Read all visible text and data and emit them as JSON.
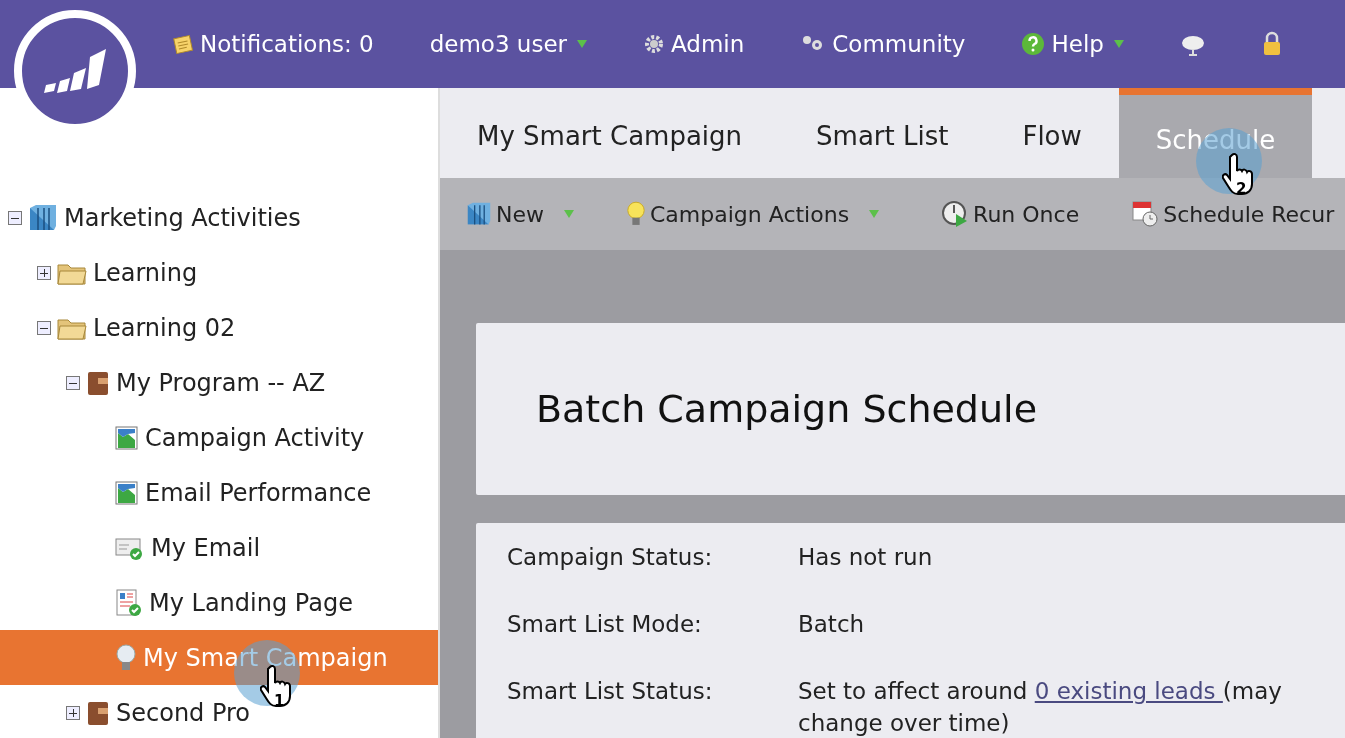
{
  "top_bar": {
    "items": [
      {
        "kind": "notifications",
        "label": "Notifications: 0",
        "has_menu": false
      },
      {
        "kind": "user",
        "label": "demo3 user",
        "has_menu": true
      },
      {
        "kind": "admin",
        "label": "Admin",
        "has_menu": false
      },
      {
        "kind": "community",
        "label": "Community",
        "has_menu": false
      },
      {
        "kind": "help",
        "label": "Help",
        "has_menu": true
      },
      {
        "kind": "cloud",
        "has_menu": false
      },
      {
        "kind": "lock",
        "has_menu": false
      }
    ]
  },
  "tree": [
    {
      "kind": "root",
      "label": "Marketing Activities",
      "expanded": true,
      "selected": false,
      "children": [
        {
          "kind": "folder",
          "label": "Learning",
          "expanded": false,
          "selected": false
        },
        {
          "kind": "folder",
          "label": "Learning 02",
          "expanded": true,
          "selected": false,
          "children": [
            {
              "kind": "program",
              "label": "My Program -- AZ",
              "expanded": true,
              "selected": false,
              "children": [
                {
                  "kind": "report",
                  "label": "Campaign Activity",
                  "selected": false
                },
                {
                  "kind": "report",
                  "label": "Email Performance",
                  "selected": false
                },
                {
                  "kind": "email",
                  "label": "My Email",
                  "selected": false
                },
                {
                  "kind": "landing",
                  "label": "My Landing Page",
                  "selected": false
                },
                {
                  "kind": "campaign",
                  "label": "My Smart Campaign",
                  "selected": true
                }
              ]
            },
            {
              "kind": "program",
              "label": "Second Pro",
              "expanded": false,
              "selected": false
            }
          ]
        }
      ]
    }
  ],
  "tabs": [
    {
      "label": "My Smart Campaign",
      "selected": false
    },
    {
      "label": "Smart List",
      "selected": false
    },
    {
      "label": "Flow",
      "selected": false
    },
    {
      "label": "Schedule",
      "selected": true
    }
  ],
  "cursor_markers": [
    {
      "number": "1"
    },
    {
      "number": "2"
    }
  ],
  "toolbar": [
    {
      "kind": "new",
      "label": "New",
      "has_menu": true
    },
    {
      "kind": "campaign",
      "label": "Campaign Actions",
      "has_menu": true
    },
    {
      "kind": "run",
      "label": "Run Once",
      "has_menu": false
    },
    {
      "kind": "schedule",
      "label": "Schedule Recur",
      "has_menu": false
    }
  ],
  "heading": "Batch Campaign Schedule",
  "details": [
    {
      "label": "Campaign Status:",
      "value": "Has not run"
    },
    {
      "label": "Smart List Mode:",
      "value": "Batch"
    },
    {
      "label": "Smart List Status:",
      "value": "Set to affect around",
      "link": "0 existing leads ",
      "value_after": "(may change over time)"
    }
  ]
}
